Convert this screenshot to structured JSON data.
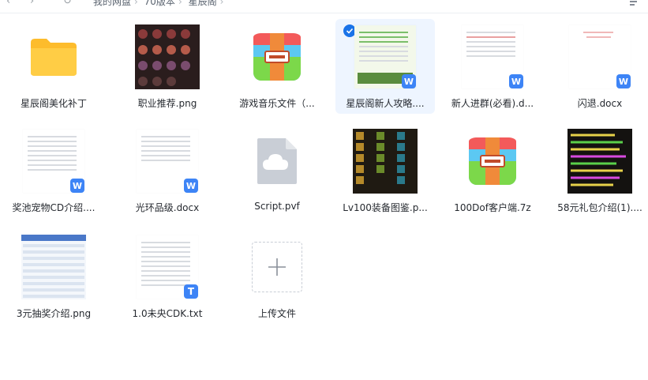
{
  "toolbar": {
    "back_icon": "arrow-left-icon",
    "forward_icon": "arrow-right-icon",
    "refresh_icon": "refresh-icon",
    "breadcrumbs": [
      "我的网盘",
      "70版本",
      "星辰阁"
    ],
    "sort_icon": "sort-icon"
  },
  "files": [
    {
      "name": "星辰阁美化补丁",
      "type": "folder"
    },
    {
      "name": "职业推荐.png",
      "type": "image"
    },
    {
      "name": "游戏音乐文件（...",
      "type": "archive"
    },
    {
      "name": "星辰阁新人攻略....",
      "type": "docx",
      "selected": true
    },
    {
      "name": "新人进群(必看).d...",
      "type": "docx"
    },
    {
      "name": "闪退.docx",
      "type": "docx"
    },
    {
      "name": "奖池宠物CD介绍....",
      "type": "docx"
    },
    {
      "name": "光环品级.docx",
      "type": "docx"
    },
    {
      "name": "Script.pvf",
      "type": "cloud"
    },
    {
      "name": "Lv100装备图鉴.p...",
      "type": "image"
    },
    {
      "name": "100Dof客户端.7z",
      "type": "archive"
    },
    {
      "name": "58元礼包介绍(1)....",
      "type": "image"
    },
    {
      "name": "3元抽奖介绍.png",
      "type": "image"
    },
    {
      "name": "1.0未央CDK.txt",
      "type": "txt"
    },
    {
      "name": "上传文件",
      "type": "upload"
    }
  ],
  "badges": {
    "word": "W",
    "text": "T"
  },
  "colors": {
    "accent": "#1a73e8",
    "badge": "#3d84f6",
    "selected_bg": "#eef5ff"
  }
}
